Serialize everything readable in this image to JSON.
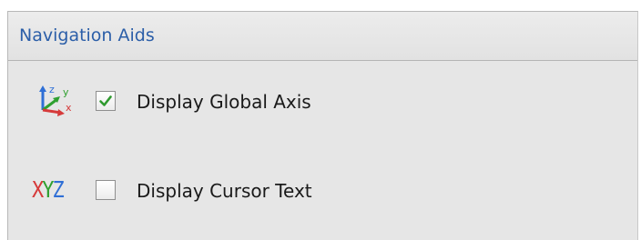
{
  "panel": {
    "title": "Navigation Aids"
  },
  "options": {
    "global_axis": {
      "label": "Display Global Axis",
      "checked": true,
      "icon": "global-axis-icon"
    },
    "cursor_text": {
      "label": "Display Cursor Text",
      "checked": false,
      "icon": "xyz-text-icon",
      "icon_text": {
        "x": "X",
        "y": "Y",
        "z": "Z"
      }
    }
  },
  "colors": {
    "title": "#2b5ea8",
    "check_mark": "#2f9a2f",
    "axis_x": "#d63a3a",
    "axis_y": "#2fa02f",
    "axis_z": "#2f6fd6"
  }
}
